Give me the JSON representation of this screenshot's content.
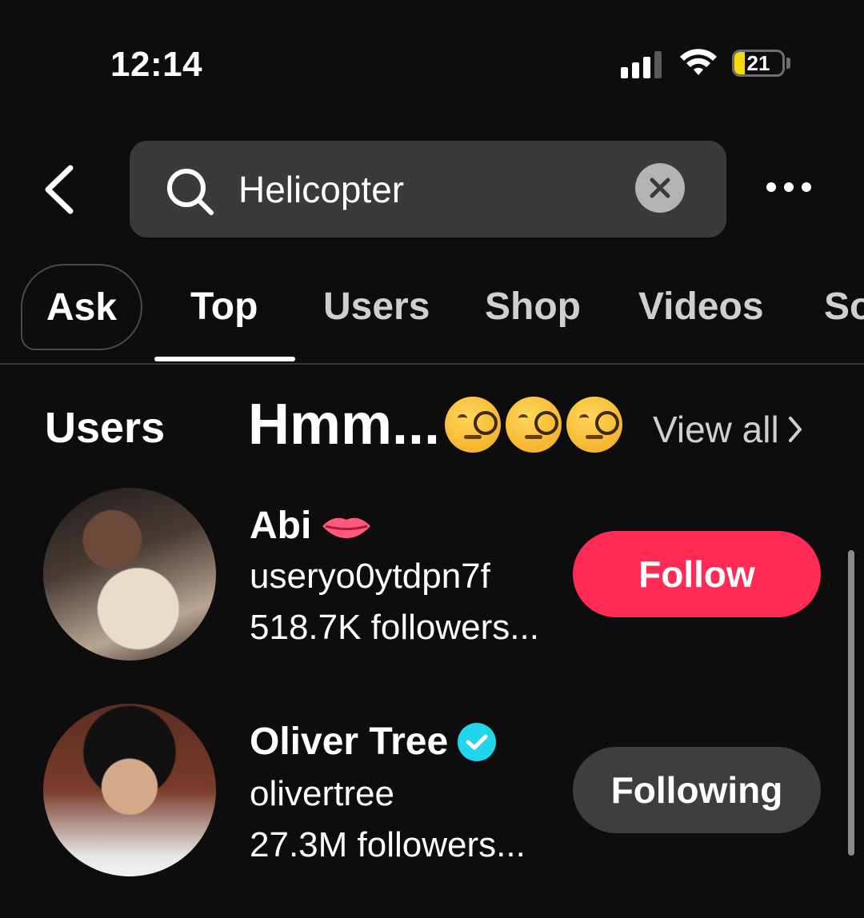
{
  "status_bar": {
    "time": "12:14",
    "battery_level": "21",
    "battery_fraction": 0.21,
    "signal_bars": 3,
    "signal_bars_total": 4,
    "icons": [
      "signal-icon",
      "wifi-icon",
      "battery-icon"
    ]
  },
  "header": {
    "back_icon": "chevron-left-icon",
    "search_icon": "search-icon",
    "search_value": "Helicopter",
    "clear_icon": "close-circle-icon",
    "more_icon": "more-horizontal-icon"
  },
  "tabs": [
    {
      "label": "Ask",
      "active": false
    },
    {
      "label": "Top",
      "active": true
    },
    {
      "label": "Users",
      "active": false
    },
    {
      "label": "Shop",
      "active": false
    },
    {
      "label": "Videos",
      "active": false
    },
    {
      "label": "So",
      "active": false
    }
  ],
  "users_section": {
    "title": "Users",
    "overlay_text": "Hmm...",
    "overlay_emoji": [
      "face-with-monocle",
      "face-with-monocle",
      "face-with-monocle"
    ],
    "view_all": "View all",
    "view_all_icon": "chevron-right-icon"
  },
  "users": [
    {
      "name": "Abi",
      "name_icon": "lips-emoji",
      "handle": "useryo0ytdpn7f",
      "followers": "518.7K followers...",
      "button": "Follow",
      "button_state": "follow"
    },
    {
      "name": "Oliver Tree",
      "name_icon": "verified-badge-icon",
      "handle": "olivertree",
      "followers": "27.3M followers...",
      "button": "Following",
      "button_state": "following"
    }
  ],
  "colors": {
    "background": "#0d0d0d",
    "follow_button": "#fe2c55",
    "following_button": "#3e3e3e",
    "verified": "#20d5ec",
    "battery_fill": "#f5d90a",
    "search_box": "#3a3a3c"
  }
}
